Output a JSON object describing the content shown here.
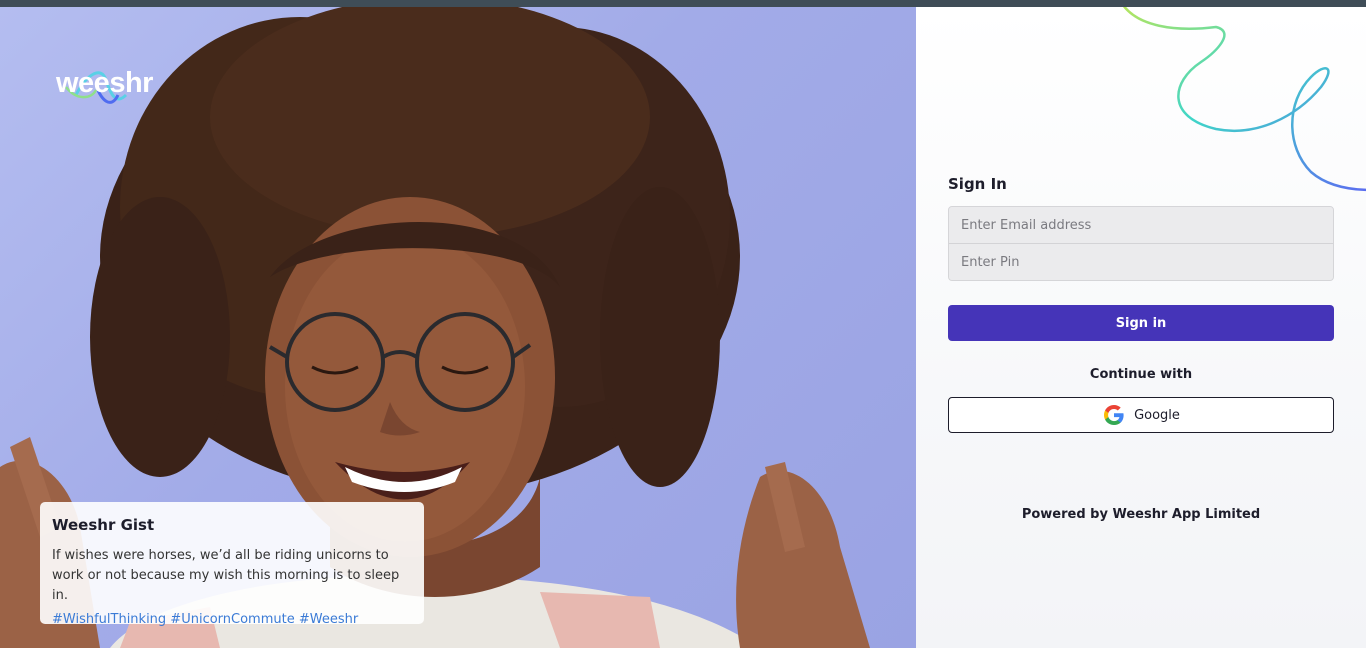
{
  "brand": {
    "logo_text": "weeshr"
  },
  "gist": {
    "title": "Weeshr Gist",
    "text": "If wishes were horses, we’d all be riding unicorns to work or not because my wish this morning is to sleep in.",
    "tags": "#WishfulThinking #UnicornCommute #Weeshr"
  },
  "signin": {
    "title": "Sign In",
    "email_placeholder": "Enter Email address",
    "pin_placeholder": "Enter Pin",
    "button_label": "Sign in",
    "continue_with": "Continue with",
    "google_label": "Google",
    "google_icon": "google-g-icon"
  },
  "footer": {
    "powered_by": "Powered by Weeshr App Limited"
  },
  "colors": {
    "primary": "#4534b8",
    "hero_bg": "#a2abe8",
    "link": "#3b7bd6",
    "topbar": "#3f4d57"
  }
}
